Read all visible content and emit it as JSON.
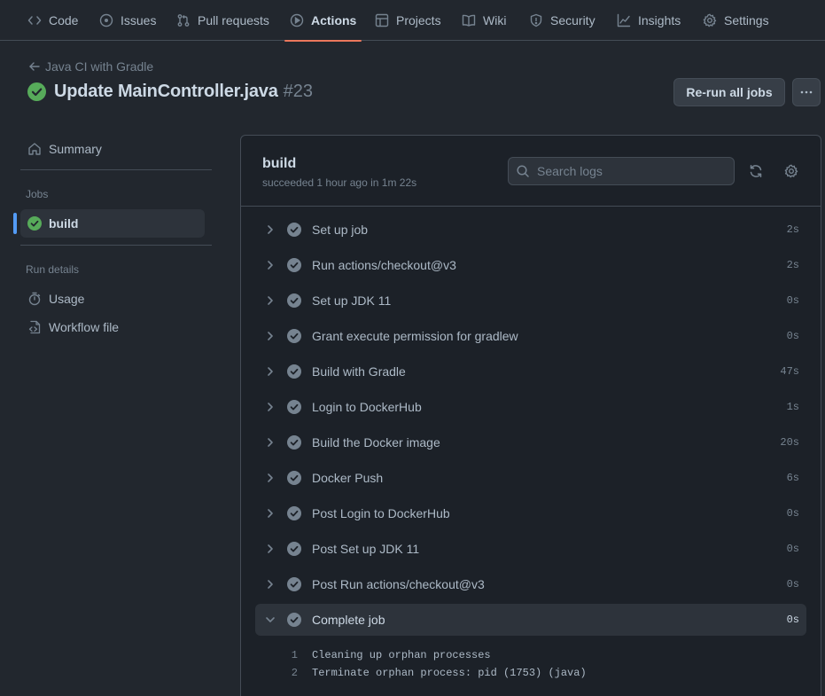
{
  "nav": {
    "tabs": [
      {
        "label": "Code",
        "icon": "code-icon"
      },
      {
        "label": "Issues",
        "icon": "issue-icon"
      },
      {
        "label": "Pull requests",
        "icon": "pull-request-icon"
      },
      {
        "label": "Actions",
        "icon": "play-icon",
        "active": true
      },
      {
        "label": "Projects",
        "icon": "table-icon"
      },
      {
        "label": "Wiki",
        "icon": "book-icon"
      },
      {
        "label": "Security",
        "icon": "shield-icon"
      },
      {
        "label": "Insights",
        "icon": "graph-icon"
      },
      {
        "label": "Settings",
        "icon": "gear-icon"
      }
    ]
  },
  "header": {
    "back_label": "Java CI with Gradle",
    "title": "Update MainController.java",
    "run_number": "#23",
    "rerun_label": "Re-run all jobs"
  },
  "sidebar": {
    "summary_label": "Summary",
    "jobs_heading": "Jobs",
    "job_label": "build",
    "run_details_heading": "Run details",
    "usage_label": "Usage",
    "workflow_label": "Workflow file"
  },
  "job": {
    "name": "build",
    "status": "succeeded 1 hour ago in 1m 22s",
    "search_placeholder": "Search logs"
  },
  "steps": [
    {
      "name": "Set up job",
      "duration": "2s"
    },
    {
      "name": "Run actions/checkout@v3",
      "duration": "2s"
    },
    {
      "name": "Set up JDK 11",
      "duration": "0s"
    },
    {
      "name": "Grant execute permission for gradlew",
      "duration": "0s"
    },
    {
      "name": "Build with Gradle",
      "duration": "47s"
    },
    {
      "name": "Login to DockerHub",
      "duration": "1s"
    },
    {
      "name": "Build the Docker image",
      "duration": "20s"
    },
    {
      "name": "Docker Push",
      "duration": "6s"
    },
    {
      "name": "Post Login to DockerHub",
      "duration": "0s"
    },
    {
      "name": "Post Set up JDK 11",
      "duration": "0s"
    },
    {
      "name": "Post Run actions/checkout@v3",
      "duration": "0s"
    },
    {
      "name": "Complete job",
      "duration": "0s",
      "expanded": true
    }
  ],
  "log_lines": [
    {
      "num": "1",
      "text": "Cleaning up orphan processes"
    },
    {
      "num": "2",
      "text": "Terminate orphan process: pid (1753) (java)"
    }
  ],
  "colors": {
    "success": "#57ab5a",
    "accent_underline": "#ec775c",
    "selection_bar": "#539bf5"
  }
}
